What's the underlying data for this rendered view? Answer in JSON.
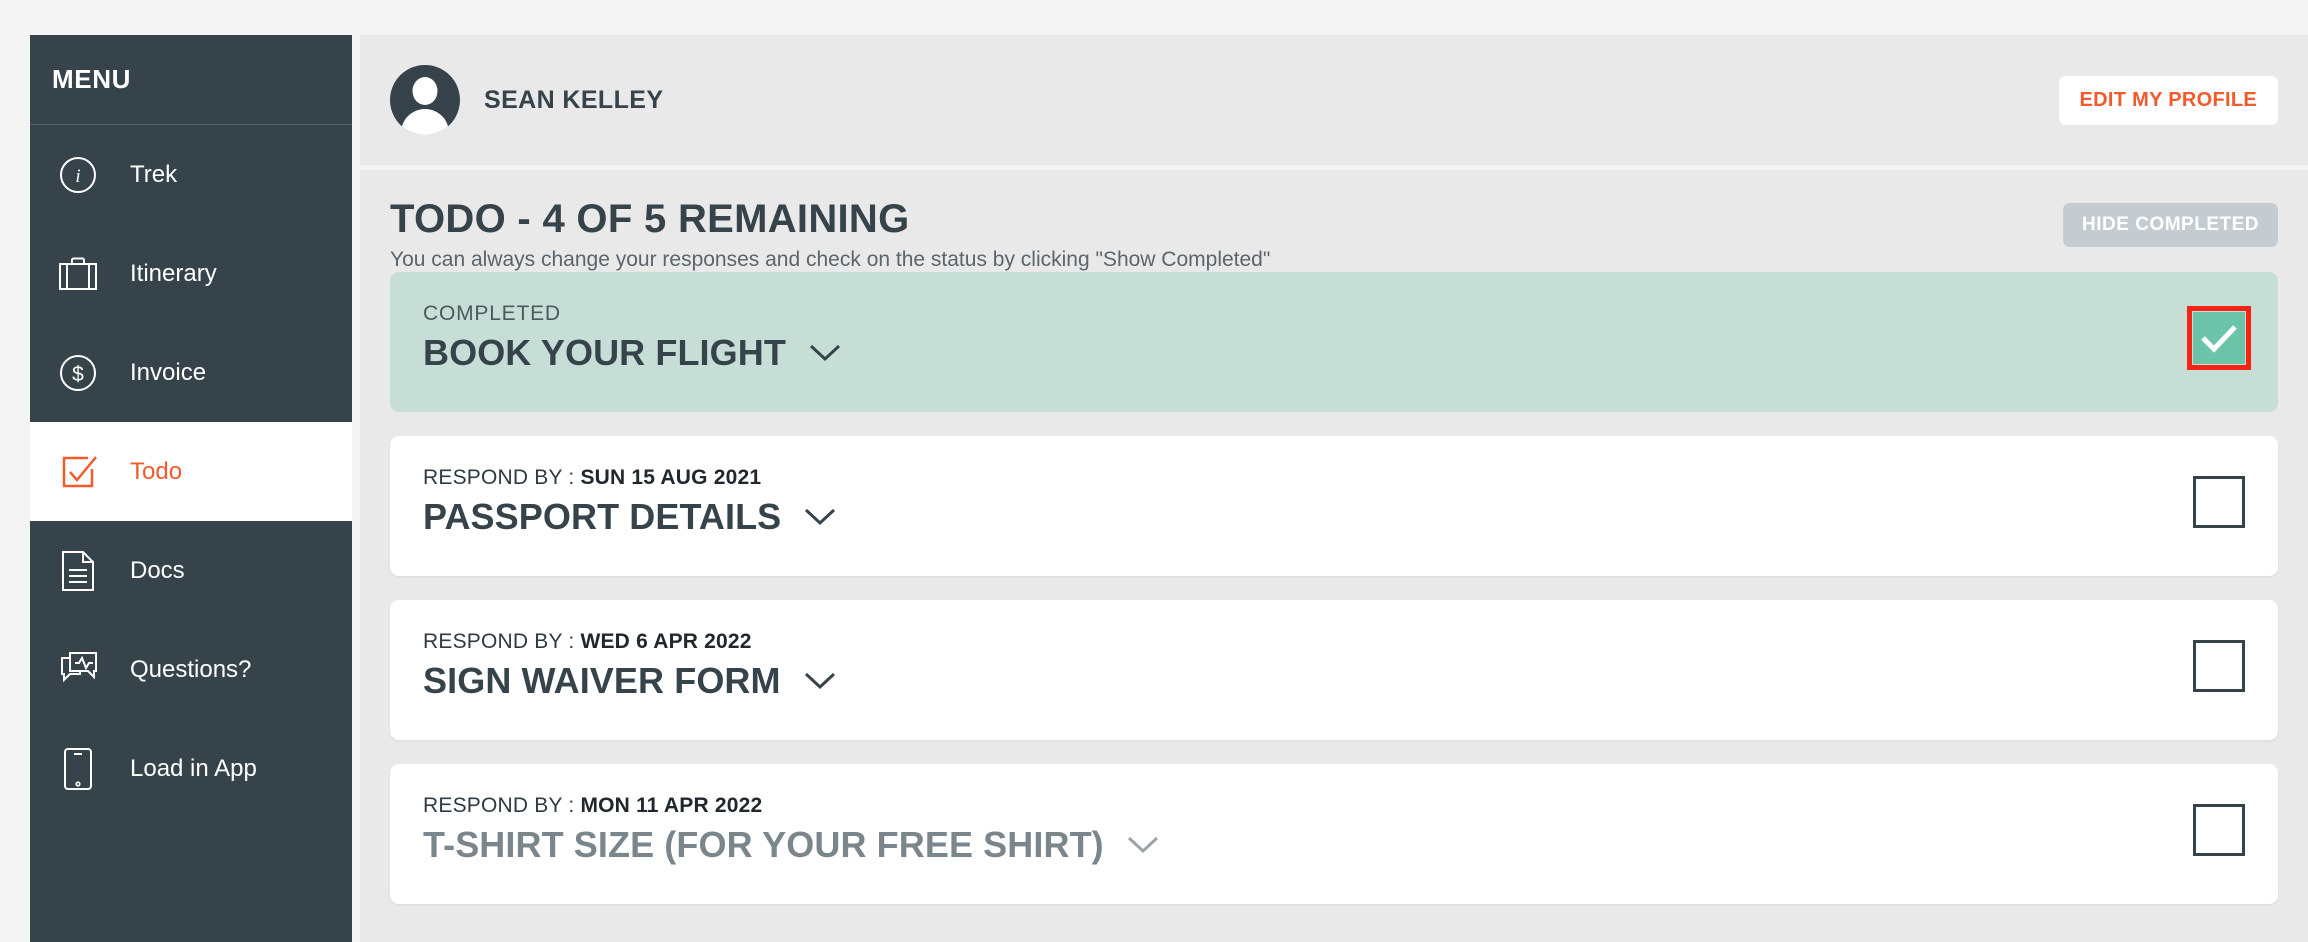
{
  "sidebar": {
    "menu_title": "MENU",
    "items": [
      {
        "label": "Trek",
        "icon": "info-circle-icon",
        "active": false
      },
      {
        "label": "Itinerary",
        "icon": "suitcase-icon",
        "active": false
      },
      {
        "label": "Invoice",
        "icon": "dollar-circle-icon",
        "active": false
      },
      {
        "label": "Todo",
        "icon": "checkbox-icon",
        "active": true
      },
      {
        "label": "Docs",
        "icon": "document-icon",
        "active": false
      },
      {
        "label": "Questions?",
        "icon": "chat-icon",
        "active": false
      },
      {
        "label": "Load in App",
        "icon": "phone-icon",
        "active": false
      }
    ]
  },
  "header": {
    "profile_name": "SEAN KELLEY",
    "edit_profile_label": "EDIT MY PROFILE",
    "avatar_icon": "user-avatar-icon"
  },
  "todo": {
    "title": "TODO - 4 OF 5 REMAINING",
    "subtitle": "You can always change your responses and check on the status by clicking \"Show Completed\"",
    "hide_completed_label": "HIDE COMPLETED",
    "items": [
      {
        "status_label": "COMPLETED",
        "meta_label": "",
        "meta_date": "",
        "name": "BOOK YOUR FLIGHT",
        "completed": true,
        "muted": false,
        "checkbox_state": "checked",
        "highlighted": true
      },
      {
        "status_label": "",
        "meta_label": "RESPOND BY : ",
        "meta_date": "SUN 15 AUG 2021",
        "name": "PASSPORT DETAILS",
        "completed": false,
        "muted": false,
        "checkbox_state": "unchecked",
        "highlighted": false
      },
      {
        "status_label": "",
        "meta_label": "RESPOND BY : ",
        "meta_date": "WED 6 APR 2022",
        "name": "SIGN WAIVER FORM",
        "completed": false,
        "muted": false,
        "checkbox_state": "unchecked",
        "highlighted": false
      },
      {
        "status_label": "",
        "meta_label": "RESPOND BY : ",
        "meta_date": "MON 11 APR 2022",
        "name": "T-SHIRT SIZE (FOR YOUR FREE SHIRT)",
        "completed": false,
        "muted": true,
        "checkbox_state": "unchecked",
        "highlighted": false
      }
    ]
  },
  "colors": {
    "sidebar_bg": "#37434b",
    "accent_orange": "#f15a2b",
    "completed_bg": "#c6ded6",
    "check_green": "#6bc3a8",
    "highlight_red": "#f42315",
    "muted_gray": "#c4ccd1"
  }
}
